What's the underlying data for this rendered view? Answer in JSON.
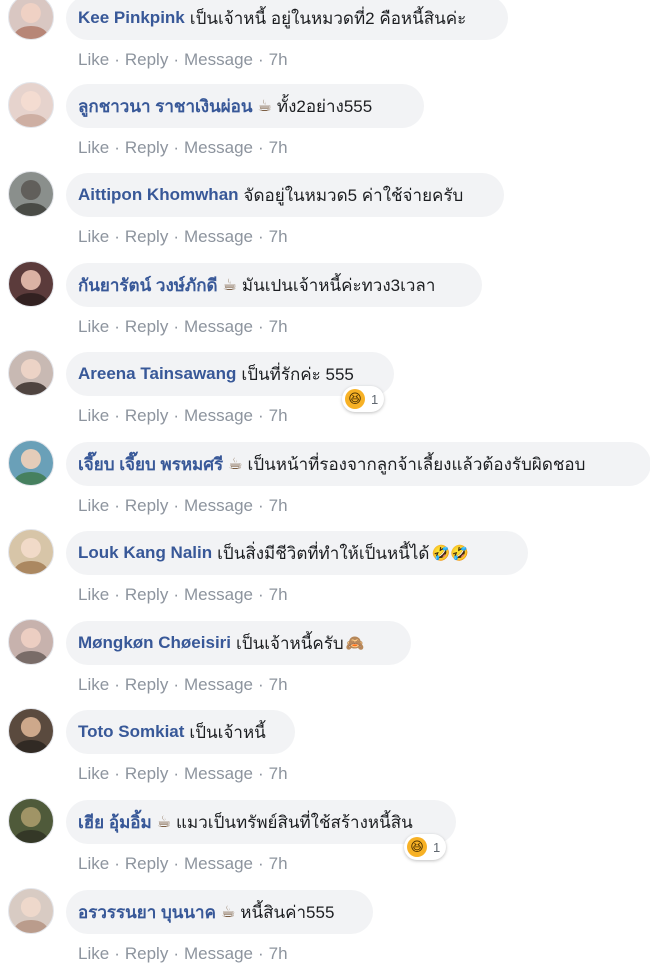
{
  "actions": {
    "like": "Like",
    "reply": "Reply",
    "message": "Message",
    "time": "7h",
    "separator": "·"
  },
  "comments": [
    {
      "name": "Kee Pinkpink",
      "text": "เป็นเจ้าหนี้ อยู่ในหมวดที่2 คือหนี้สินค่ะ",
      "coffee": false,
      "emoji": "",
      "reaction": null,
      "avatar": {
        "bg": "#d9c7c2",
        "face": "#f1d2c4",
        "body": "#b07a6a"
      }
    },
    {
      "name": "ลูกชาวนา ราชาเงินผ่อน",
      "text": "ทั้ง2อย่าง555",
      "coffee": true,
      "emoji": "",
      "reaction": null,
      "avatar": {
        "bg": "#e6d3cd",
        "face": "#f5ddd1",
        "body": "#c9a89b"
      }
    },
    {
      "name": "Aittipon Khomwhan",
      "text": "จัดอยู่ในหมวด5 ค่าใช้จ่ายครับ",
      "coffee": false,
      "emoji": "",
      "reaction": null,
      "avatar": {
        "bg": "#8a8f8c",
        "face": "#5c5a55",
        "body": "#3d3f3a"
      }
    },
    {
      "name": "กันยารัตน์ วงษ์ภักดี",
      "text": "มันเปนเจ้าหนี้ค่ะทวง3เวลา",
      "coffee": true,
      "emoji": "",
      "reaction": null,
      "avatar": {
        "bg": "#5b3b3b",
        "face": "#e9c0b0",
        "body": "#2b1d1d"
      }
    },
    {
      "name": "Areena Tainsawang",
      "text": "เป็นที่รักค่ะ 555",
      "coffee": false,
      "emoji": "",
      "reaction": {
        "emoji": "😆",
        "count": "1"
      },
      "avatar": {
        "bg": "#c8b9b3",
        "face": "#f0d6c8",
        "body": "#3a2f2c"
      }
    },
    {
      "name": "เจี๊ยบ เจี๊ยบ พรหมศรี",
      "text": "เป็นหน้าที่รองจากลูกจ้าเลี้ยงแล้วต้องรับผิดชอบ",
      "coffee": true,
      "emoji": "",
      "reaction": null,
      "avatar": {
        "bg": "#6aa0b8",
        "face": "#f2d0b9",
        "body": "#3f7a4f"
      }
    },
    {
      "name": "Louk Kang Nalin",
      "text": "เป็นสิ่งมีชีวิตที่ทำให้เป็นหนี้ได้",
      "coffee": false,
      "emoji": "🤣🤣",
      "reaction": null,
      "avatar": {
        "bg": "#d7c5a8",
        "face": "#f4dccb",
        "body": "#a37c55"
      }
    },
    {
      "name": "Møngkøn Chøeisiri",
      "text": "เป็นเจ้าหนี้ครับ",
      "coffee": false,
      "emoji": "🙈",
      "reaction": null,
      "avatar": {
        "bg": "#c7b2ad",
        "face": "#efd0c4",
        "body": "#6b5f5c"
      }
    },
    {
      "name": "Toto Somkiat",
      "text": "เป็นเจ้าหนี้",
      "coffee": false,
      "emoji": "",
      "reaction": null,
      "avatar": {
        "bg": "#5a4a3e",
        "face": "#d9b294",
        "body": "#2a2420"
      }
    },
    {
      "name": "เฮีย อุ้มอิ้ม",
      "text": "แมวเป็นทรัพย์สินที่ใช้สร้างหนี้สิน",
      "coffee": true,
      "emoji": "",
      "reaction": {
        "emoji": "😆",
        "count": "1"
      },
      "avatar": {
        "bg": "#4f5a3a",
        "face": "#a89a6b",
        "body": "#2f3324"
      }
    },
    {
      "name": "อรวรรนยา บุนนาค",
      "text": "หนี้สินค่า555",
      "coffee": true,
      "emoji": "",
      "reaction": null,
      "avatar": {
        "bg": "#d8cbc3",
        "face": "#f1d9cc",
        "body": "#b59483"
      }
    }
  ]
}
